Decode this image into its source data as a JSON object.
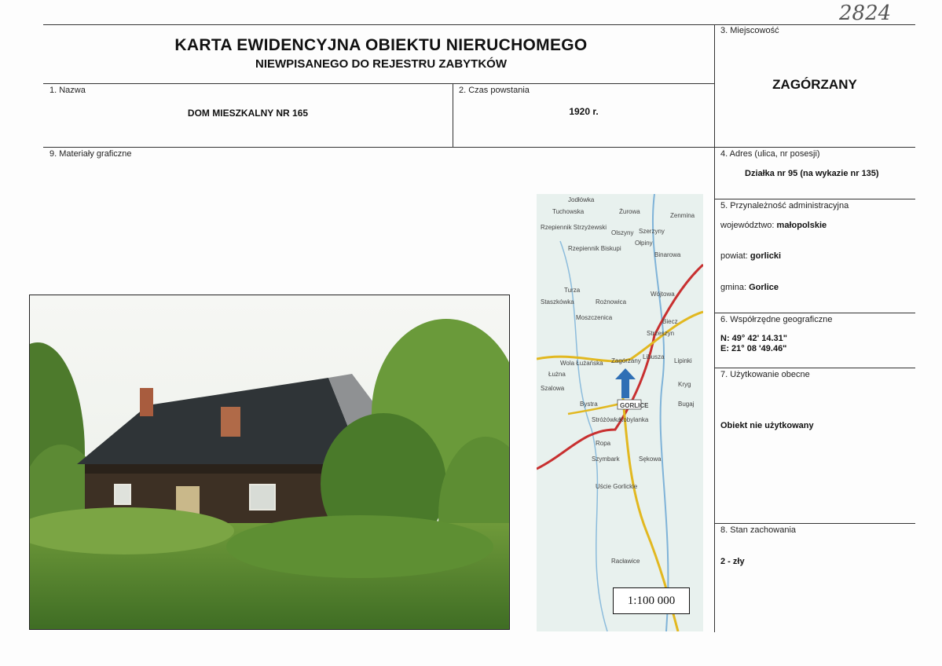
{
  "document_number": "2824",
  "header": {
    "title": "KARTA EWIDENCYJNA OBIEKTU NIERUCHOMEGO",
    "subtitle": "NIEWPISANEGO DO REJESTRU ZABYTKÓW"
  },
  "fields": {
    "name": {
      "label": "1. Nazwa",
      "value": "DOM MIESZKALNY NR 165"
    },
    "period": {
      "label": "2. Czas powstania",
      "value": "1920 r."
    },
    "locality": {
      "label": "3. Miejscowość",
      "value": "ZAGÓRZANY"
    },
    "address": {
      "label": "4. Adres (ulica, nr posesji)",
      "value": "Działka nr 95 (na wykazie nr 135)"
    },
    "admin": {
      "label": "5. Przynależność administracyjna",
      "voivodeship_label": "województwo:",
      "voivodeship": "małopolskie",
      "county_label": "powiat:",
      "county": "gorlicki",
      "commune_label": "gmina:",
      "commune": "Gorlice"
    },
    "coords": {
      "label": "6. Współrzędne geograficzne",
      "n": "N: 49° 42' 14.31\"",
      "e": "E: 21° 08 '49.46\""
    },
    "usage": {
      "label": "7. Użytkowanie obecne",
      "value": "Obiekt nie użytkowany"
    },
    "condition": {
      "label": "8. Stan zachowania",
      "value": "2 - zły"
    },
    "graphics": {
      "label": "9. Materiały graficzne"
    }
  },
  "map": {
    "scale": "1:100 000",
    "places": [
      "Jodłówka",
      "Tuchowska",
      "Żurowa",
      "Rzepiennik Strzyżewski",
      "Olszyny",
      "Szerzyny",
      "Ołpiny",
      "Rzepiennik Biskupi",
      "Turza",
      "Staszkówka",
      "Rożnowica",
      "Moszczenica",
      "Biecz",
      "Strzeszyn",
      "Zagórzany",
      "Libusza",
      "Wola Łużańska",
      "Łużna",
      "Szalowa",
      "Bystra",
      "Stróżówka",
      "Kobylanka",
      "GORLICE",
      "Ropa",
      "Szymbark",
      "Sękowa",
      "Uście Gorlickie",
      "Racławice",
      "Binarowa",
      "Wójtowa",
      "Lipinki",
      "Kryg",
      "Bugaj",
      "Zenmina"
    ]
  },
  "colors": {
    "road_red": "#c83030",
    "road_yellow": "#e2b820",
    "map_bg": "#e8f1ee",
    "marker_blue": "#2f6fb5"
  }
}
